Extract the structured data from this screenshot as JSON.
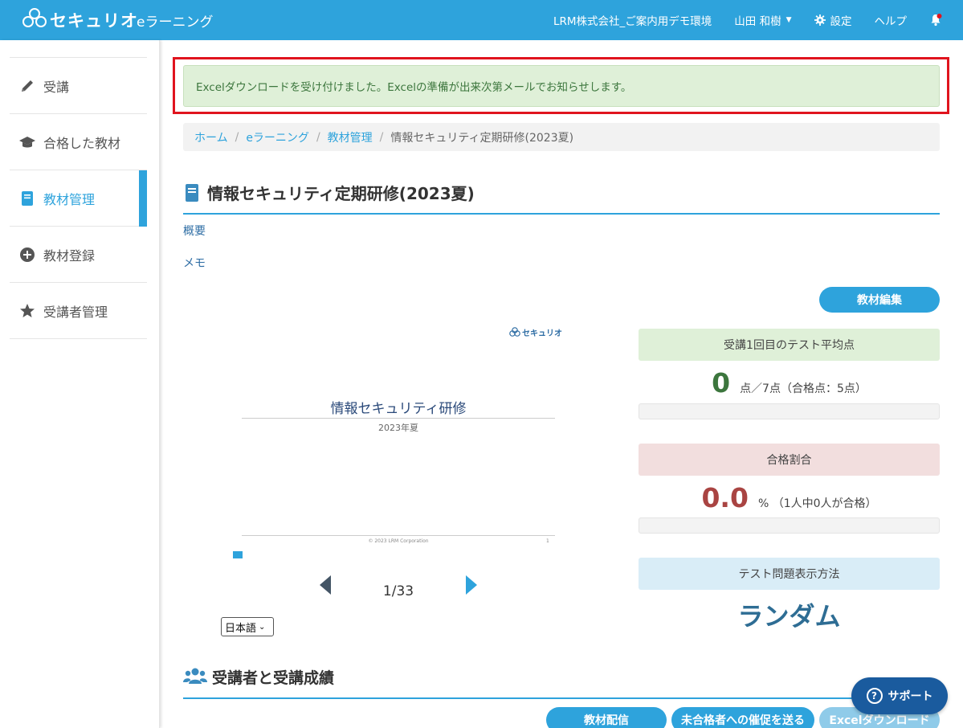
{
  "header": {
    "logo_text": "セキュリオ",
    "app_name": "eラーニング",
    "org": "LRM株式会社_ご案内用デモ環境",
    "user": "山田 和樹",
    "settings": "設定",
    "help": "ヘルプ"
  },
  "sidebar": {
    "items": [
      {
        "label": "受講",
        "icon": "pencil-icon"
      },
      {
        "label": "合格した教材",
        "icon": "graduation-cap-icon"
      },
      {
        "label": "教材管理",
        "icon": "book-icon"
      },
      {
        "label": "教材登録",
        "icon": "plus-circle-icon"
      },
      {
        "label": "受講者管理",
        "icon": "star-icon"
      }
    ],
    "active_index": 2
  },
  "alert": {
    "message": "Excelダウンロードを受け付けました。Excelの準備が出来次第メールでお知らせします。"
  },
  "breadcrumb": [
    "ホーム",
    "eラーニング",
    "教材管理",
    "情報セキュリティ定期研修(2023夏)"
  ],
  "course": {
    "title": "情報セキュリティ定期研修(2023夏)",
    "overview_label": "概要",
    "memo_label": "メモ",
    "edit_button": "教材編集"
  },
  "slide": {
    "logo_text": "セキュリオ",
    "title": "情報セキュリティ研修",
    "subtitle": "2023年夏",
    "copyright": "© 2023 LRM Corporation",
    "page_no": "1"
  },
  "pager": {
    "current": 1,
    "total": 33,
    "label": "1/33",
    "language": "日本語"
  },
  "stats": {
    "avg_label": "受講1回目のテスト平均点",
    "avg_value": "0",
    "avg_unit": "点／7点（合格点：5点）",
    "avg_fraction": 0.0,
    "pass_label": "合格割合",
    "pass_value": "0.0",
    "pass_unit": "%  （1人中0人が合格）",
    "pass_fraction": 0.0,
    "method_label": "テスト問題表示方法",
    "method_value": "ランダム"
  },
  "section2": {
    "title": "受講者と受講成績",
    "buttons": [
      "教材配信",
      "未合格者への催促を送る",
      "Excelダウンロード"
    ]
  },
  "support": "サポート",
  "colors": {
    "primary": "#2ea3dc",
    "avg_bg": "#dff0d8",
    "avg_num": "#3c763d",
    "pass_bg": "#f2dede",
    "pass_num": "#a94442",
    "method_bg": "#d9edf7",
    "alert_border": "#e0141e"
  }
}
